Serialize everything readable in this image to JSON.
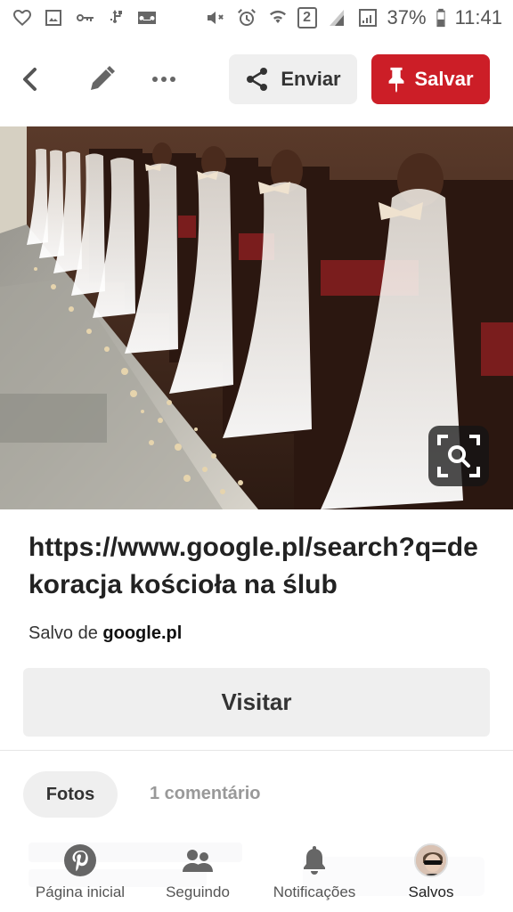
{
  "status_bar": {
    "battery": "37%",
    "time": "11:41",
    "sim_indicator": "2",
    "left_icons": [
      "heart-outline-icon",
      "image-icon",
      "key-icon",
      "usb-icon",
      "voicemail-icon"
    ],
    "right_icons": [
      "mute-icon",
      "alarm-icon",
      "wifi-icon",
      "sim2-icon",
      "signal-icon",
      "signal-icon",
      "battery-icon"
    ]
  },
  "actionbar": {
    "send_label": "Enviar",
    "save_label": "Salvar",
    "save_color": "#cc1e27",
    "icons": [
      "chevron-left-icon",
      "pencil-icon",
      "more-icon",
      "share-icon",
      "pin-icon"
    ]
  },
  "pin": {
    "image_alt": "church pews decorated with tulle and bows, petals on aisle",
    "link_title": "https://www.google.pl/search?q=dekoracja kościoła na ślub",
    "saved_from_prefix": "Salvo de",
    "saved_from_domain": "google.pl",
    "visit_label": "Visitar"
  },
  "tabs": {
    "photos_label": "Fotos",
    "comments_label": "1 comentário"
  },
  "bottom_nav": {
    "items": [
      {
        "label": "Página inicial",
        "icon": "pinterest-icon"
      },
      {
        "label": "Seguindo",
        "icon": "people-icon"
      },
      {
        "label": "Notificações",
        "icon": "bell-icon"
      },
      {
        "label": "Salvos",
        "icon": "avatar"
      }
    ]
  }
}
